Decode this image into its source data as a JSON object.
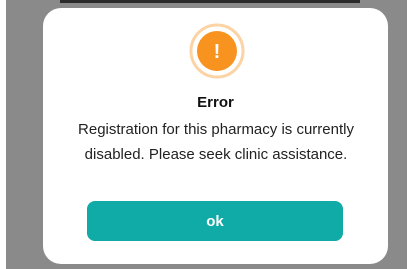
{
  "dialog": {
    "icon": "warning-exclamation-icon",
    "icon_symbol": "!",
    "title": "Error",
    "message": "Registration for this pharmacy is currently disabled. Please seek clinic assistance.",
    "ok_label": "ok"
  },
  "colors": {
    "accent": "#10aba6",
    "warning": "#f7931e",
    "warning_ring": "#fbd3a4",
    "backdrop": "#8a8a8a"
  }
}
